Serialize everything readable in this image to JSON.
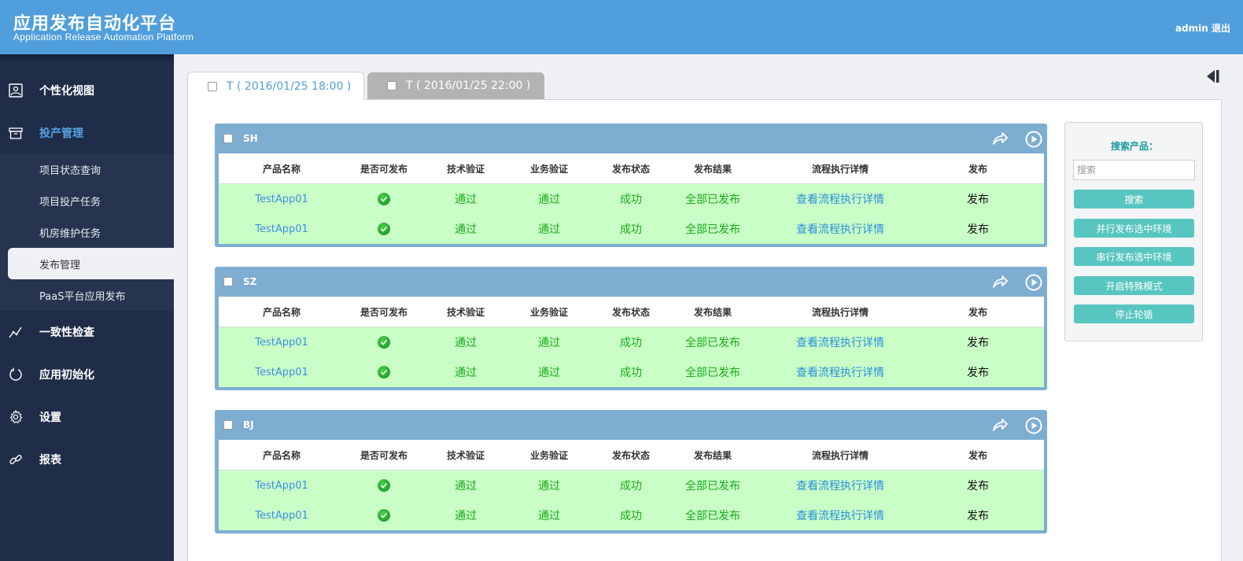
{
  "header": {
    "title": "应用发布自动化平台",
    "subtitle": "Application Release Automation Platform",
    "user": "admin",
    "logout": "退出"
  },
  "sidebar": {
    "items": [
      {
        "label": "个性化视图",
        "icon": "image-icon"
      },
      {
        "label": "投产管理",
        "icon": "box-icon"
      },
      {
        "label": "一致性检查",
        "icon": "line-chart-icon"
      },
      {
        "label": "应用初始化",
        "icon": "refresh-icon"
      },
      {
        "label": "设置",
        "icon": "gear-icon"
      },
      {
        "label": "报表",
        "icon": "link-icon"
      }
    ],
    "subitems": [
      "项目状态查询",
      "项目投产任务",
      "机房维护任务",
      "发布管理",
      "PaaS平台应用发布"
    ]
  },
  "tabs": [
    {
      "label": "T ( 2016/01/25 18:00 )"
    },
    {
      "label": "T ( 2016/01/25 22:00 )"
    }
  ],
  "columns": [
    "产品名称",
    "是否可发布",
    "技术验证",
    "业务验证",
    "发布状态",
    "发布结果",
    "流程执行详情",
    "发布"
  ],
  "envs": [
    {
      "name": "SH",
      "rows": [
        {
          "product": "TestApp01",
          "tech": "通过",
          "biz": "通过",
          "status": "成功",
          "result": "全部已发布",
          "detail": "查看流程执行详情",
          "action": "发布"
        },
        {
          "product": "TestApp01",
          "tech": "通过",
          "biz": "通过",
          "status": "成功",
          "result": "全部已发布",
          "detail": "查看流程执行详情",
          "action": "发布"
        }
      ]
    },
    {
      "name": "SZ",
      "rows": [
        {
          "product": "TestApp01",
          "tech": "通过",
          "biz": "通过",
          "status": "成功",
          "result": "全部已发布",
          "detail": "查看流程执行详情",
          "action": "发布"
        },
        {
          "product": "TestApp01",
          "tech": "通过",
          "biz": "通过",
          "status": "成功",
          "result": "全部已发布",
          "detail": "查看流程执行详情",
          "action": "发布"
        }
      ]
    },
    {
      "name": "BJ",
      "rows": [
        {
          "product": "TestApp01",
          "tech": "通过",
          "biz": "通过",
          "status": "成功",
          "result": "全部已发布",
          "detail": "查看流程执行详情",
          "action": "发布"
        },
        {
          "product": "TestApp01",
          "tech": "通过",
          "biz": "通过",
          "status": "成功",
          "result": "全部已发布",
          "detail": "查看流程执行详情",
          "action": "发布"
        }
      ]
    }
  ],
  "search": {
    "label": "搜索产品：",
    "placeholder": "搜索",
    "buttons": [
      "搜索",
      "并行发布选中环境",
      "串行发布选中环境",
      "开启特殊模式",
      "停止轮循"
    ]
  },
  "colors": {
    "header": "#509fdc",
    "sidebar": "#1f2d48",
    "env_header": "#7eadd2",
    "row_bg": "#c9fec6",
    "accent_teal": "#58c6c0"
  }
}
